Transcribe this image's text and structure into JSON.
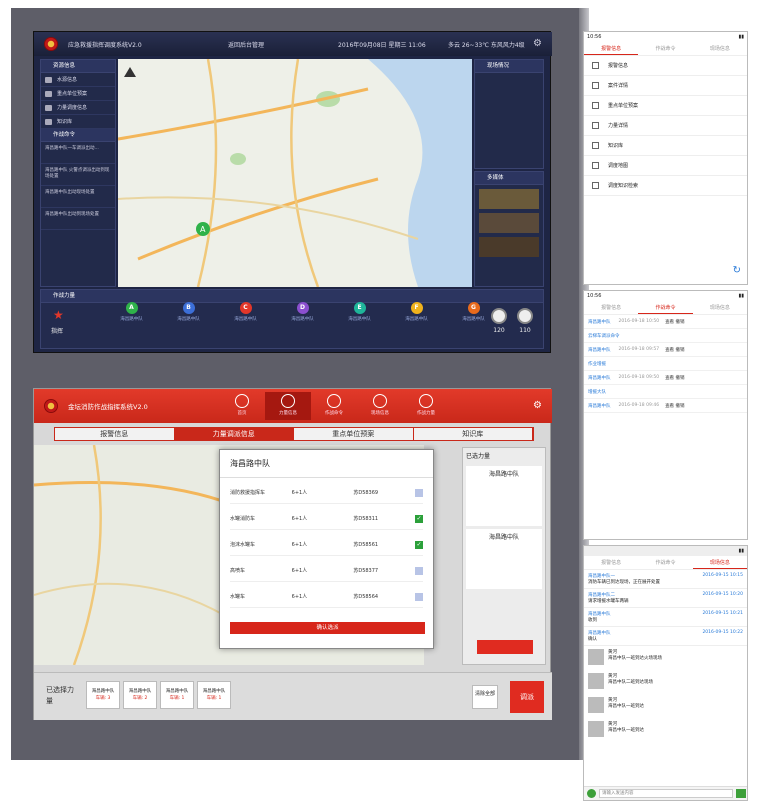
{
  "monitor1": {
    "title": "应急救援指挥调度系统V2.0",
    "back_button": "返回后台管理",
    "datetime": "2016年09月08日 星期三 11:06",
    "weather": "多云 26~33℃ 东风风力4级",
    "left_panel": {
      "header": "资源信息",
      "items": [
        "水源信息",
        "重点单位预案",
        "力量调度信息",
        "知识库"
      ],
      "orders_header": "作战命令",
      "orders": [
        "海昌路中队一车调派出动...",
        "海昌路中队 火警点调派出动到现场处置",
        "海昌路中队出动现场处置",
        "海昌路中队出动到现场处置"
      ]
    },
    "right_panel": {
      "header1": "现场情况",
      "header2": "多媒体"
    },
    "bottom": {
      "header": "作战力量",
      "commander": "指挥",
      "circles": [
        {
          "letter": "A",
          "label": "海昌路中队",
          "color": "#2fb24a"
        },
        {
          "letter": "B",
          "label": "海昌路中队",
          "color": "#3c6fd8"
        },
        {
          "letter": "C",
          "label": "海昌路中队",
          "color": "#e2372a"
        },
        {
          "letter": "D",
          "label": "海昌路中队",
          "color": "#8b4fcf"
        },
        {
          "letter": "E",
          "label": "海昌路中队",
          "color": "#1fb59a"
        },
        {
          "letter": "F",
          "label": "海昌路中队",
          "color": "#f0b21c"
        },
        {
          "letter": "G",
          "label": "海昌路中队",
          "color": "#e86a1c"
        }
      ],
      "counts": [
        "120",
        "110"
      ]
    }
  },
  "monitor2": {
    "title": "金坛消防作战指挥系统V2.0",
    "nav": [
      "首页",
      "力量信息",
      "作战命令",
      "现场信息",
      "作战力量"
    ],
    "tabs": [
      "报警信息",
      "力量调派信息",
      "重点单位预案",
      "知识库"
    ],
    "right_title": "已选力量",
    "right_unit": "海昌路中队",
    "modal": {
      "title": "海昌路中队",
      "rows": [
        {
          "name": "消防救援指挥车",
          "crew": "6+1人",
          "plate": "苏D58369",
          "checked": false
        },
        {
          "name": "水罐消防车",
          "crew": "6+1人",
          "plate": "苏D58311",
          "checked": true
        },
        {
          "name": "泡沫水罐车",
          "crew": "6+1人",
          "plate": "苏D58561",
          "checked": true
        },
        {
          "name": "高喷车",
          "crew": "6+1人",
          "plate": "苏D58377",
          "checked": false
        },
        {
          "name": "水罐车",
          "crew": "6+1人",
          "plate": "苏D58564",
          "checked": false
        }
      ],
      "confirm": "确认选派"
    },
    "bottom": {
      "selected_label": "已选择力量",
      "chips": [
        {
          "name": "海昌路中队",
          "count": "车辆: 3"
        },
        {
          "name": "海昌路中队",
          "count": "车辆: 2"
        },
        {
          "name": "海昌路中队",
          "count": "车辆: 1"
        },
        {
          "name": "海昌路中队",
          "count": "车辆: 1"
        }
      ],
      "clear": "清除全部",
      "execute": "调派"
    }
  },
  "phone1": {
    "time": "10:56",
    "tabs": [
      "报警信息",
      "作战命令",
      "现场信息"
    ],
    "items": [
      "报警信息",
      "案件详情",
      "重点单位预案",
      "力量详情",
      "知识库",
      "调度地图",
      "调度知识检索"
    ]
  },
  "phone2": {
    "time": "10:56",
    "tabs": [
      "报警信息",
      "作战命令",
      "现场信息"
    ],
    "rows": [
      {
        "tag": "海昌路中队",
        "time": "2016-09-18 10:50",
        "act": "查看 撤销"
      },
      {
        "tag": "云梯车调派命令",
        "time": "",
        "act": ""
      },
      {
        "tag": "海昌路中队",
        "time": "2016-09-18 09:57",
        "act": "查看 撤销"
      },
      {
        "tag": "作业增援",
        "time": "",
        "act": ""
      },
      {
        "tag": "海昌路中队",
        "time": "2016-09-18 09:50",
        "act": "查看 撤销"
      },
      {
        "tag": "增援大队",
        "time": "",
        "act": ""
      },
      {
        "tag": "海昌路中队",
        "time": "2016-09-18 09:46",
        "act": "查看 撤销"
      }
    ]
  },
  "phone3": {
    "tabs": [
      "报警信息",
      "作战命令",
      "现场信息"
    ],
    "chats": [
      {
        "who": "海昌路中队一",
        "time": "2016-09-15 10:15",
        "text": "消防车辆已到达现场，正在展开处置"
      },
      {
        "who": "海昌路中队二",
        "time": "2016-09-15 10:20",
        "text": "请求增援水罐车两辆"
      },
      {
        "who": "海昌路中队",
        "time": "2016-09-15 10:21",
        "text": "收到"
      },
      {
        "who": "海昌路中队",
        "time": "2016-09-15 10:22",
        "text": "确认"
      }
    ],
    "msgs": [
      {
        "name": "黄河",
        "text": "海昌中队一班到达火场现场"
      },
      {
        "name": "黄河",
        "text": "海昌中队二班到达现场"
      },
      {
        "name": "黄河",
        "text": "海昌中队一班到达"
      },
      {
        "name": "黄河",
        "text": "海昌中队一班到达"
      }
    ],
    "input_placeholder": "请输入发送内容"
  }
}
